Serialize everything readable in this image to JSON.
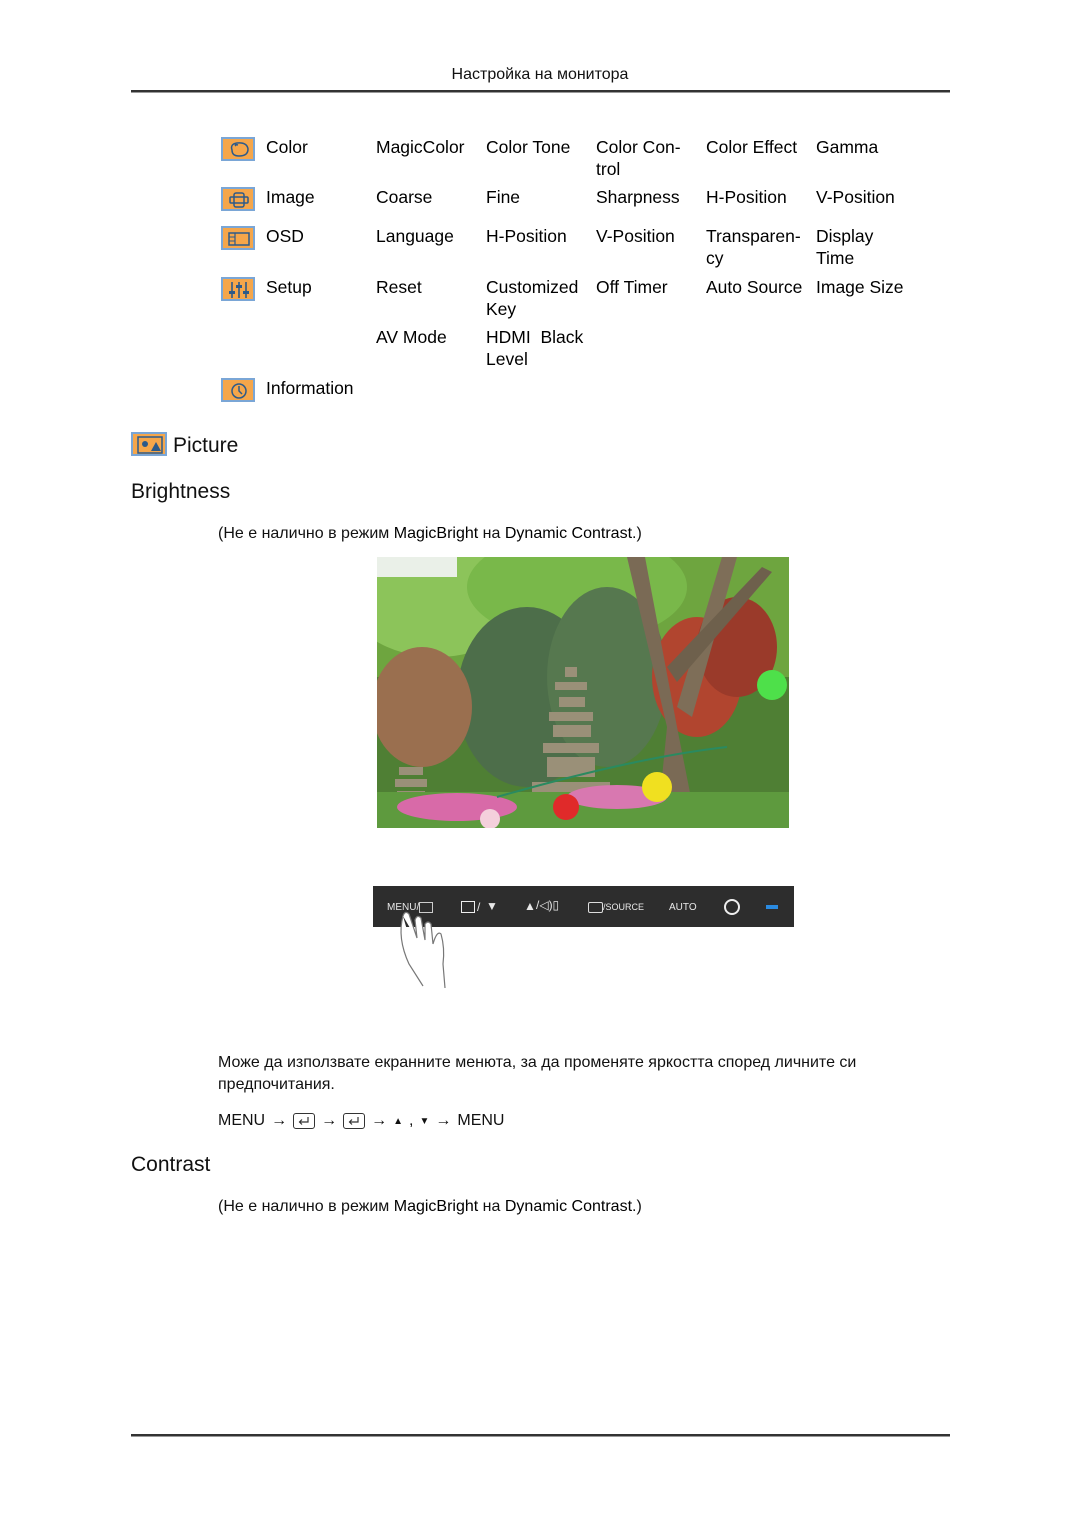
{
  "header": {
    "title": "Настройка на монитора"
  },
  "menu_table": {
    "rows": [
      {
        "icon": "color-icon",
        "name": "Color",
        "items": [
          "MagicColor",
          "Color Tone",
          "Color Con-\ntrol",
          "Color Effect",
          "Gamma"
        ]
      },
      {
        "icon": "image-icon",
        "name": "Image",
        "items": [
          "Coarse",
          "Fine",
          "Sharpness",
          "H-Position",
          "V-Position"
        ]
      },
      {
        "icon": "osd-icon",
        "name": "OSD",
        "items": [
          "Language",
          "H-Position",
          "V-Position",
          "Transparen-\ncy",
          "Display\nTime"
        ]
      },
      {
        "icon": "setup-icon",
        "name": "Setup",
        "items": [
          "Reset",
          "Customized\nKey",
          "Off Timer",
          "Auto Source",
          "Image Size"
        ]
      },
      {
        "icon": "",
        "name": "",
        "items": [
          "AV Mode",
          "HDMI  Black\nLevel",
          "",
          "",
          ""
        ]
      },
      {
        "icon": "information-icon",
        "name": "Information",
        "items": [
          "",
          "",
          "",
          "",
          ""
        ]
      }
    ]
  },
  "sections": {
    "picture": {
      "title": "Picture"
    },
    "brightness": {
      "title": "Brightness",
      "note_prefix": "(Не е налично в режим ",
      "note_mode": "MagicBright",
      "note_mid": " на ",
      "note_value": "Dynamic Contrast",
      "note_suffix": ".)",
      "description": "Може да използвате екранните менюта, за да променяте яркостта според личните си предпочитания.",
      "sequence": {
        "start": "MENU",
        "arrow": "→",
        "up": "▲",
        "comma": ",",
        "down": "▼",
        "end": "MENU"
      }
    },
    "contrast": {
      "title": "Contrast",
      "note_prefix": "(Не е налично в режим ",
      "note_mode": "MagicBright",
      "note_mid": " на ",
      "note_value": "Dynamic Contrast",
      "note_suffix": ".)"
    }
  },
  "button_panel": {
    "labels": {
      "menu": "MENU/",
      "source": "/SOURCE",
      "auto": "AUTO",
      "slash": "/"
    },
    "colors": {
      "panel": "#2d2d2d",
      "led": "#2a8ae0"
    }
  },
  "colors": {
    "icon_fill": "#f5a64a",
    "icon_border": "#7aa6d6"
  }
}
